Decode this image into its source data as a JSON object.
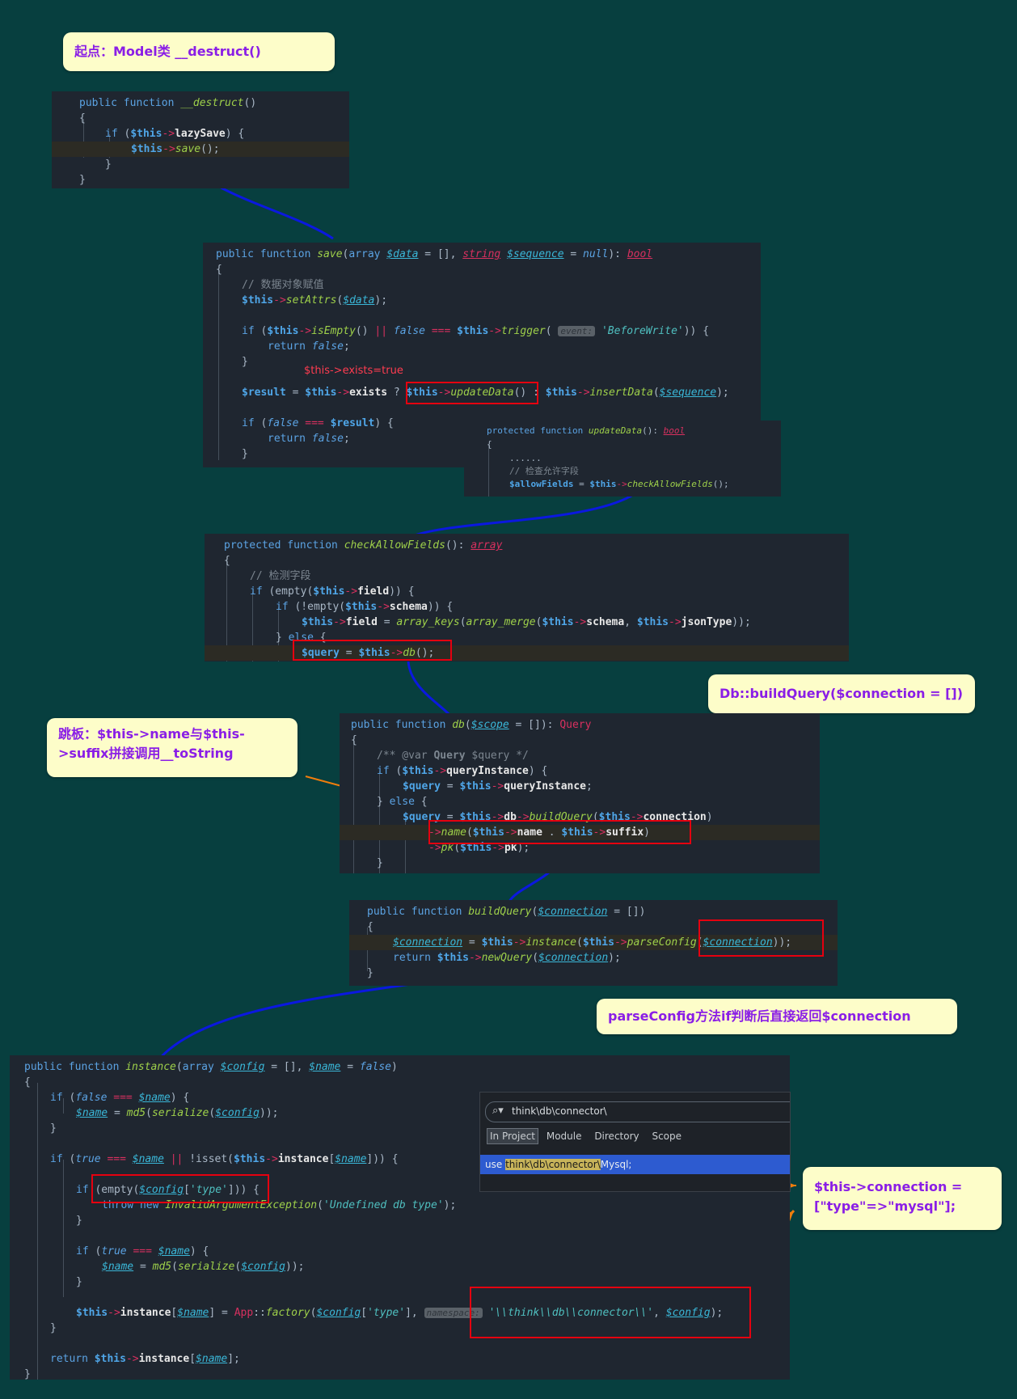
{
  "notes": {
    "start": "起点：Model类 __destruct()",
    "db_build_query": "Db::buildQuery($connection = [])",
    "trampoline": "跳板：$this->name与$this->suffix拼接调用__toString",
    "parse_config": "parseConfig方法if判断后直接返回$connection",
    "connection_type": "$this->connection = [\"type\"=>\"mysql\"];"
  },
  "annotations": {
    "exists_true": "$this->exists=true"
  },
  "popup": {
    "search_value": "think\\db\\connector\\",
    "tabs": [
      "In Project",
      "Module",
      "Directory",
      "Scope"
    ],
    "result_prefix": "use ",
    "result_match": "think\\db\\connector\\",
    "result_suffix": "Mysql;"
  },
  "colors": {
    "background": "#073f3f",
    "note_bg": "#fdfdc9",
    "note_text": "#8a1ee6",
    "code_bg": "#1f2630",
    "arrow_blue": "#0b18e0",
    "arrow_orange": "#f07d0c",
    "arrow_green": "#0d7a12",
    "highlight_box": "#e5000f"
  }
}
